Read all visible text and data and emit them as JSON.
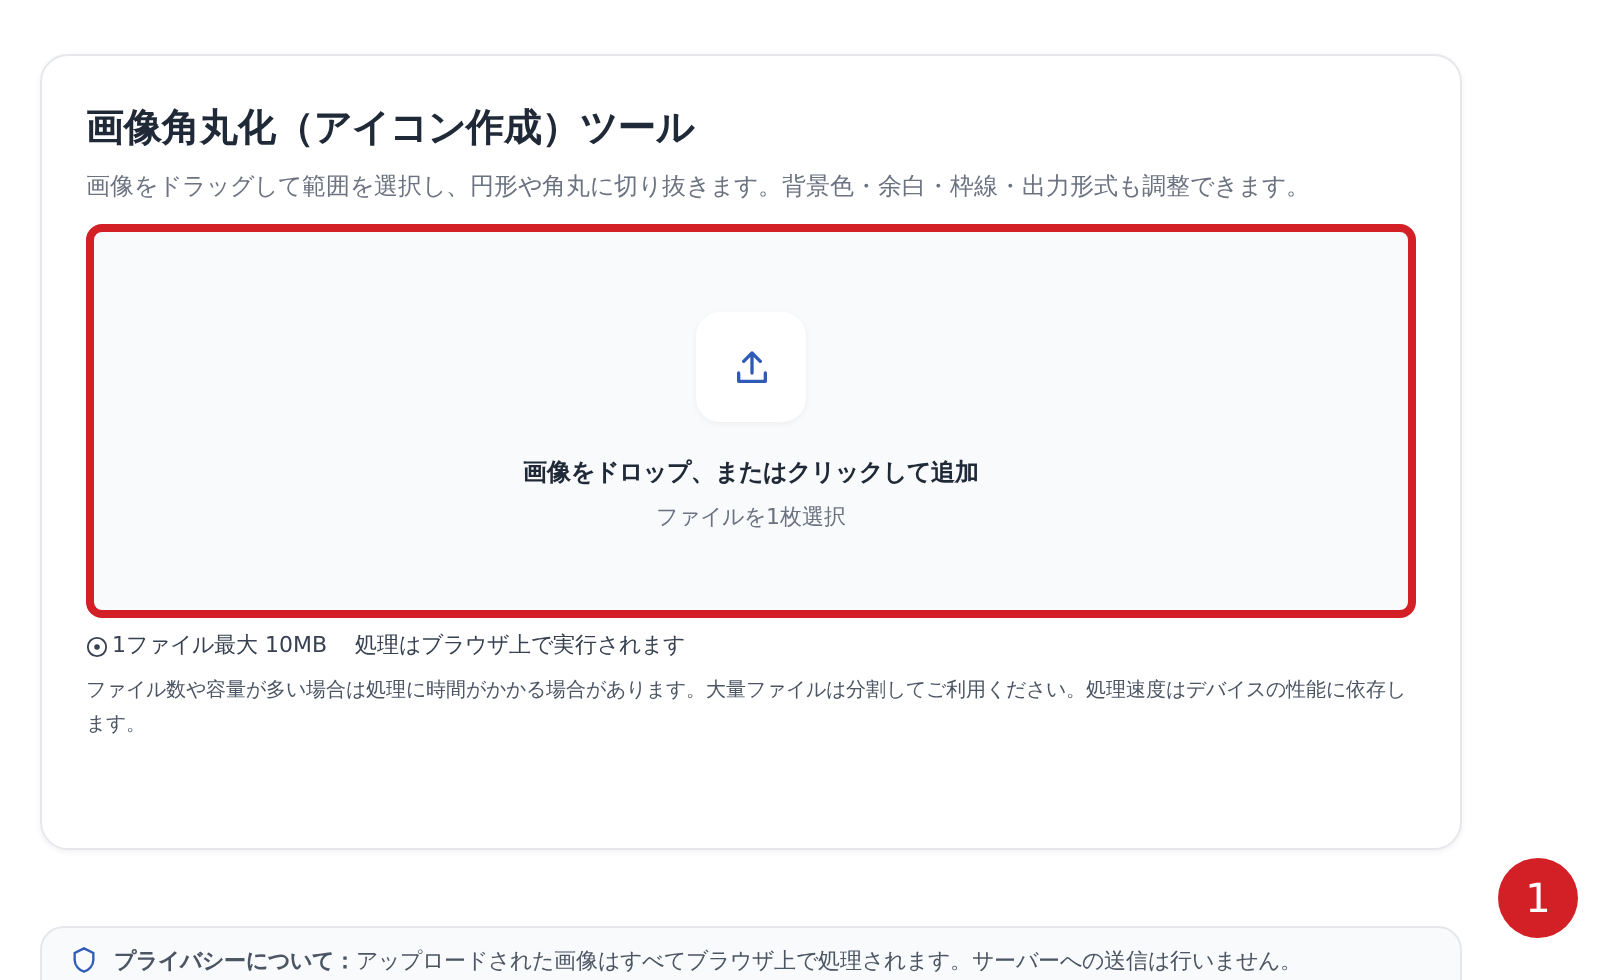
{
  "tool_card": {
    "title": "画像角丸化（アイコン作成）ツール",
    "description": "画像をドラッグして範囲を選択し、円形や角丸に切り抜きます。背景色・余白・枠線・出力形式も調整できます。",
    "dropzone": {
      "title": "画像をドロップ、またはクリックして追加",
      "subtitle": "ファイルを1枚選択",
      "highlighted": true
    },
    "limits": [
      "1ファイル最大 10MB",
      "処理はブラウザ上で実行されます"
    ],
    "note": "ファイル数や容量が多い場合は処理に時間がかかる場合があります。大量ファイルは分割してご利用ください。処理速度はデバイスの性能に依存します。"
  },
  "annotation_badge": "1",
  "privacy": {
    "label": "プライバシーについて：",
    "text": "アップロードされた画像はすべてブラウザ上で処理されます。サーバーへの送信は行いません。"
  }
}
